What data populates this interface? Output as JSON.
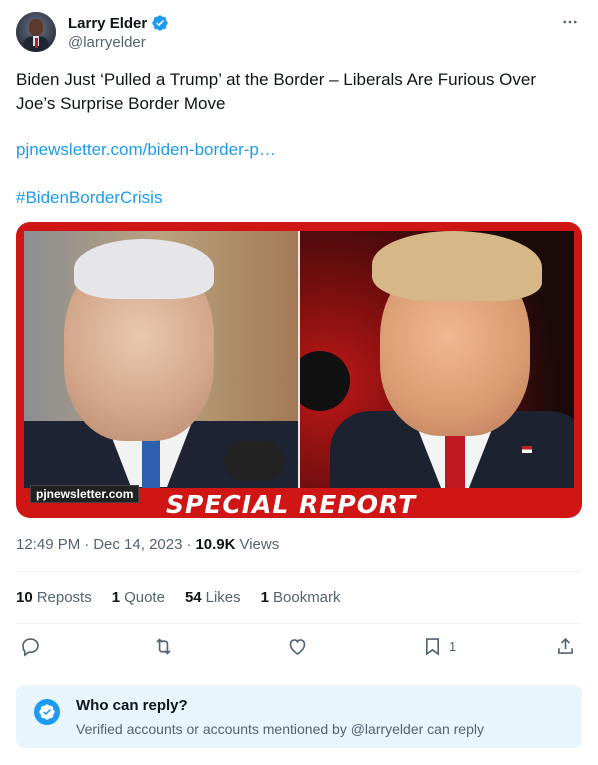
{
  "author": {
    "name": "Larry Elder",
    "handle": "@larryelder"
  },
  "tweet": {
    "text_line1": "Biden Just ‘Pulled a Trump’ at the Border – Liberals Are Furious Over",
    "text_line2": "Joe’s Surprise Border Move",
    "link": "pjnewsletter.com/biden-border-p…",
    "hashtag": "#BidenBorderCrisis"
  },
  "media": {
    "site_tag": "pjnewsletter.com",
    "banner": "SPECIAL REPORT"
  },
  "meta": {
    "time": "12:49 PM",
    "dot1": "·",
    "date": "Dec 14, 2023",
    "dot2": "·",
    "views_count": "10.9K",
    "views_label": "Views"
  },
  "stats": {
    "reposts_count": "10",
    "reposts_label": "Reposts",
    "quotes_count": "1",
    "quotes_label": "Quote",
    "likes_count": "54",
    "likes_label": "Likes",
    "bookmarks_count": "1",
    "bookmarks_label": "Bookmark"
  },
  "actions": {
    "bookmark_count": "1"
  },
  "reply_restriction": {
    "title": "Who can reply?",
    "description": "Verified accounts or accounts mentioned by @larryelder can reply"
  },
  "colors": {
    "accent": "#1d9bf0",
    "text": "#0f1419",
    "muted": "#536471",
    "banner_red": "#d01515"
  }
}
